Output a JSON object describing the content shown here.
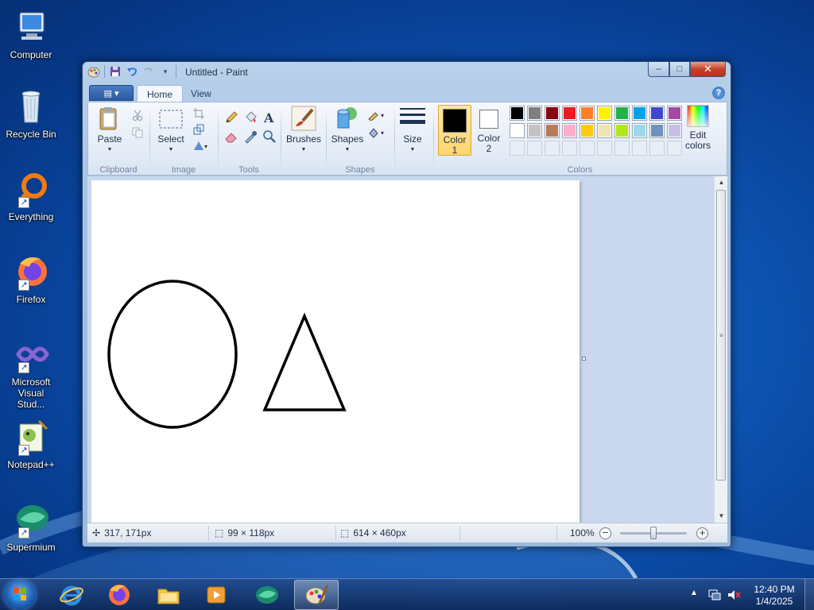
{
  "desktop": {
    "icons": [
      {
        "label": "Computer",
        "icon": "computer-icon"
      },
      {
        "label": "Recycle Bin",
        "icon": "recycle-bin-icon"
      },
      {
        "label": "Everything",
        "icon": "everything-icon"
      },
      {
        "label": "Firefox",
        "icon": "firefox-icon"
      },
      {
        "label": "Microsoft Visual Stud...",
        "icon": "visual-studio-icon"
      },
      {
        "label": "Notepad++",
        "icon": "notepadpp-icon"
      },
      {
        "label": "Supermium",
        "icon": "supermium-icon"
      }
    ]
  },
  "window": {
    "title": "Untitled - Paint",
    "caption": {
      "minimize": "–",
      "maximize": "□",
      "close": "✕"
    }
  },
  "ribbon": {
    "file_menu": "▤ ▾",
    "tabs": [
      {
        "label": "Home",
        "active": true
      },
      {
        "label": "View",
        "active": false
      }
    ],
    "help": "?",
    "groups": {
      "clipboard": {
        "label": "Clipboard",
        "paste": "Paste"
      },
      "image": {
        "label": "Image",
        "select": "Select"
      },
      "tools": {
        "label": "Tools"
      },
      "brushes": {
        "label": "Brushes"
      },
      "shapes": {
        "label": "Shapes",
        "button": "Shapes"
      },
      "size": {
        "label": "Size"
      },
      "colors": {
        "label": "Colors",
        "color1": {
          "line1": "Color",
          "line2": "1",
          "value": "#000000"
        },
        "color2": {
          "line1": "Color",
          "line2": "2",
          "value": "#ffffff"
        },
        "edit_line1": "Edit",
        "edit_line2": "colors",
        "palette_row1": [
          "#000000",
          "#7f7f7f",
          "#880015",
          "#ed1c24",
          "#ff7f27",
          "#fff200",
          "#22b14c",
          "#00a2e8",
          "#3f48cc",
          "#a349a4"
        ],
        "palette_row2": [
          "#ffffff",
          "#c3c3c3",
          "#b97a57",
          "#ffaec9",
          "#ffc90e",
          "#efe4b0",
          "#b5e61d",
          "#99d9ea",
          "#7092be",
          "#c8bfe7"
        ]
      }
    }
  },
  "status": {
    "cursor_pos": "317, 171px",
    "selection_size": "99 × 118px",
    "image_size": "614 × 460px",
    "zoom": "100%",
    "zoom_out": "−",
    "zoom_in": "+"
  },
  "taskbar": {
    "apps": [
      "internet-explorer-icon",
      "firefox-icon",
      "file-explorer-icon",
      "media-player-icon",
      "supermium-icon",
      "paint-icon"
    ],
    "time": "12:40 PM",
    "date": "1/4/2025"
  },
  "colors": {
    "accent": "#2b5aa3",
    "window_frame": "#b9d1ea",
    "workspace": "#c9d8ec"
  }
}
